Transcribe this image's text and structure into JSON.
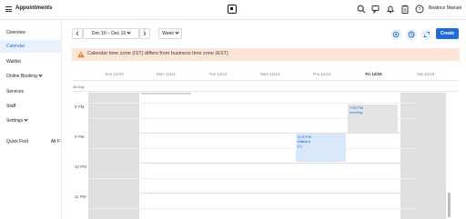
{
  "app": {
    "title": "Appointments",
    "user_name": "Beatrice Manuel"
  },
  "top_icons": [
    "search-icon",
    "chat-icon",
    "bell-icon",
    "clipboard-icon",
    "help-icon"
  ],
  "sidebar": {
    "items": [
      {
        "label": "Overview"
      },
      {
        "label": "Calendar"
      },
      {
        "label": "Waitlist"
      },
      {
        "label": "Online Booking"
      },
      {
        "label": "Services"
      },
      {
        "label": "Staff"
      },
      {
        "label": "Settings"
      }
    ],
    "quick_find": {
      "label": "Quick Find",
      "shortcut": "Alt F"
    }
  },
  "toolbar": {
    "date_range": "Dec 10 – Dec 16",
    "view": "Week",
    "create_label": "Create"
  },
  "banner": {
    "text": "Calendar time zone (IST) differs from business time zone (EST)"
  },
  "calendar": {
    "days": [
      "Sun 12/10",
      "Mon 12/11",
      "Tue 12/12",
      "Wed 12/13",
      "Thu 12/14",
      "Fri 12/15",
      "Sat 12/16"
    ],
    "today_index": 5,
    "all_day_label": "All Day",
    "hours": [
      "8 PM",
      "9 PM",
      "10 PM",
      "11 PM"
    ],
    "events": [
      {
        "time": "7:00 PM",
        "title": "meeting",
        "extra": ""
      },
      {
        "time": "9:00 PM",
        "title": "Class 1",
        "extra": "(1)"
      }
    ]
  },
  "colors": {
    "accent": "#1f6ad6",
    "banner_bg": "#fbe5d6"
  }
}
